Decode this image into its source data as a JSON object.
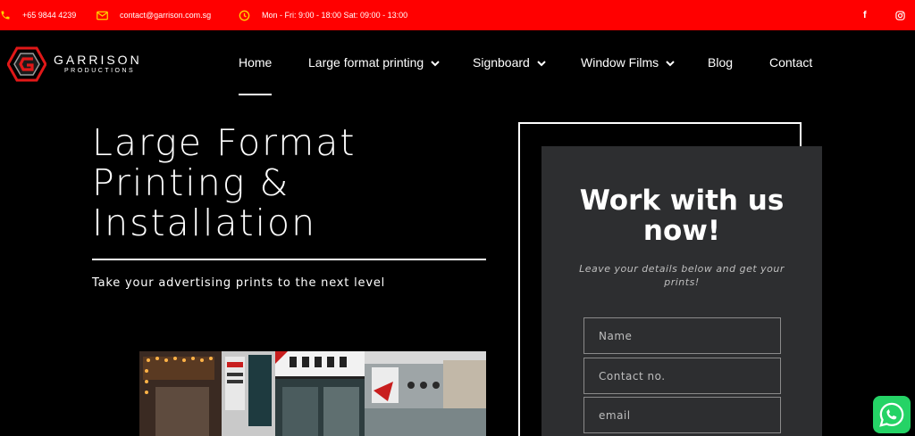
{
  "topbar": {
    "phone": "+65 9844 4239",
    "email": "contact@garrison.com.sg",
    "hours": "Mon - Fri: 9:00 - 18:00 Sat: 09:00 - 13:00",
    "facebook_glyph": "f",
    "icons": [
      "phone-icon",
      "mail-icon",
      "clock-icon",
      "facebook-icon",
      "instagram-icon"
    ],
    "background": "#ff0000"
  },
  "logo": {
    "name": "GARRISON",
    "sub": "PRODUCTIONS"
  },
  "nav": {
    "items": [
      {
        "label": "Home",
        "dropdown": false,
        "active": true
      },
      {
        "label": "Large format printing",
        "dropdown": true
      },
      {
        "label": "Signboard",
        "dropdown": true
      },
      {
        "label": "Window Films",
        "dropdown": true
      },
      {
        "label": "Blog",
        "dropdown": false
      },
      {
        "label": "Contact",
        "dropdown": false
      }
    ]
  },
  "hero": {
    "title_lines": [
      "Large Format",
      "Printing &",
      "Installation"
    ],
    "subtitle": "Take your advertising prints to the next level"
  },
  "form": {
    "title": "Work with us now!",
    "description": "Leave your details below and get your prints!",
    "fields": {
      "name_placeholder": "Name",
      "contact_placeholder": "Contact no.",
      "email_placeholder": "email"
    }
  },
  "colors": {
    "accent": "#ff0000",
    "card": "#2d2e30",
    "whatsapp": "#25d366"
  }
}
